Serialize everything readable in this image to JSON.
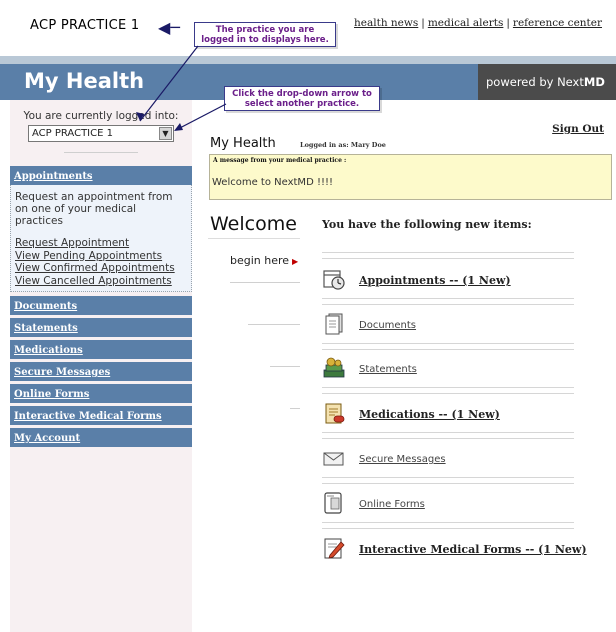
{
  "header": {
    "practice_title": "ACP PRACTICE 1",
    "links": [
      "health news",
      "medical alerts",
      "reference center"
    ]
  },
  "callouts": {
    "practice_note": "The practice you are logged in to displays here.",
    "dropdown_note": "Click the drop-down arrow to select another practice."
  },
  "banner": {
    "title": "My Health",
    "powered_prefix": "powered by Next",
    "powered_suffix": "MD"
  },
  "sidebar": {
    "login_label": "You are currently logged into:",
    "practice_select_value": "ACP PRACTICE 1",
    "appointments_heading": "Appointments",
    "appointments_desc": "Request an appointment from on one of your medical practices",
    "appointment_links": [
      "Request Appointment",
      "View Pending Appointments",
      "View Confirmed Appointments",
      "View Cancelled Appointments"
    ],
    "nav": [
      "Documents",
      "Statements",
      "Medications",
      "Secure Messages",
      "Online Forms",
      "Interactive Medical Forms",
      "My Account"
    ]
  },
  "main": {
    "sign_out": "Sign Out",
    "title": "My Health",
    "logged_in_as": "Logged in as: Mary Doe",
    "message_label": "A message from your medical practice :",
    "message_text": "Welcome to NextMD !!!!",
    "welcome": "Welcome",
    "begin_here": "begin here",
    "items_heading": "You have the following new items:",
    "items": [
      {
        "label": "Appointments -- (1 New)",
        "icon": "calendar-clock-icon"
      },
      {
        "label": "Documents",
        "icon": "document-icon"
      },
      {
        "label": "Statements",
        "icon": "money-icon"
      },
      {
        "label": "Medications -- (1 New)",
        "icon": "medication-icon"
      },
      {
        "label": "Secure Messages",
        "icon": "envelope-icon"
      },
      {
        "label": "Online Forms",
        "icon": "form-icon"
      },
      {
        "label": "Interactive Medical Forms -- (1 New)",
        "icon": "pencil-form-icon"
      }
    ]
  },
  "colors": {
    "banner": "#5a7fa8",
    "sidebar_bg": "#f7f0f2",
    "message_bg": "#fdfacb",
    "callout_text": "#6b1f8a"
  }
}
